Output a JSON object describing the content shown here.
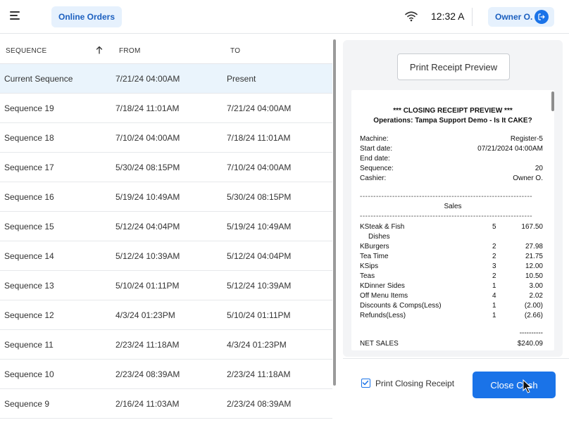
{
  "header": {
    "tab_label": "Online Orders",
    "time": "12:32 A",
    "user_name": "Owner O.",
    "menu_icon": "hamburger-menu-icon",
    "wifi_icon": "wifi-icon",
    "logout_icon": "logout-icon"
  },
  "table": {
    "columns": {
      "sequence": "SEQUENCE",
      "from": "FROM",
      "to": "TO"
    },
    "rows": [
      {
        "sequence": "Current Sequence",
        "from": "7/21/24 04:00AM",
        "to": "Present"
      },
      {
        "sequence": "Sequence 19",
        "from": "7/18/24 11:01AM",
        "to": "7/21/24 04:00AM"
      },
      {
        "sequence": "Sequence 18",
        "from": "7/10/24 04:00AM",
        "to": "7/18/24 11:01AM"
      },
      {
        "sequence": "Sequence 17",
        "from": "5/30/24 08:15PM",
        "to": "7/10/24 04:00AM"
      },
      {
        "sequence": "Sequence 16",
        "from": "5/19/24 10:49AM",
        "to": "5/30/24 08:15PM"
      },
      {
        "sequence": "Sequence 15",
        "from": "5/12/24 04:04PM",
        "to": "5/19/24 10:49AM"
      },
      {
        "sequence": "Sequence 14",
        "from": "5/12/24 10:39AM",
        "to": "5/12/24 04:04PM"
      },
      {
        "sequence": "Sequence 13",
        "from": "5/10/24 01:11PM",
        "to": "5/12/24 10:39AM"
      },
      {
        "sequence": "Sequence 12",
        "from": "4/3/24 01:23PM",
        "to": "5/10/24 01:11PM"
      },
      {
        "sequence": "Sequence 11",
        "from": "2/23/24 11:18AM",
        "to": "4/3/24 01:23PM"
      },
      {
        "sequence": "Sequence 10",
        "from": "2/23/24 08:39AM",
        "to": "2/23/24 11:18AM"
      },
      {
        "sequence": "Sequence 9",
        "from": "2/16/24 11:03AM",
        "to": "2/23/24 08:39AM"
      }
    ]
  },
  "panel": {
    "preview_button": "Print Receipt Preview",
    "receipt": {
      "title": "*** CLOSING RECEIPT PREVIEW ***",
      "subtitle": "Operations: Tampa Support Demo - Is It CAKE?",
      "info": [
        {
          "label": "Machine:",
          "value": "Register-5"
        },
        {
          "label": "Start date:",
          "value": "07/21/2024 04:00AM"
        },
        {
          "label": "End date:",
          "value": ""
        },
        {
          "label": "Sequence:",
          "value": "20"
        },
        {
          "label": "Cashier:",
          "value": "Owner O."
        }
      ],
      "dashes": "----------------------------------------------------------------",
      "sales_label": "Sales",
      "items": [
        {
          "name": "KSteak & Fish",
          "qty": "5",
          "amount": "167.50"
        },
        {
          "name": "Dishes",
          "qty": "",
          "amount": ""
        },
        {
          "name": "KBurgers",
          "qty": "2",
          "amount": "27.98"
        },
        {
          "name": "Tea Time",
          "qty": "2",
          "amount": "21.75"
        },
        {
          "name": "KSips",
          "qty": "3",
          "amount": "12.00"
        },
        {
          "name": "Teas",
          "qty": "2",
          "amount": "10.50"
        },
        {
          "name": "KDinner Sides",
          "qty": "1",
          "amount": "3.00"
        },
        {
          "name": "Off Menu Items",
          "qty": "4",
          "amount": "2.02"
        },
        {
          "name": "Discounts & Comps(Less)",
          "qty": "1",
          "amount": "(2.00)"
        },
        {
          "name": "Refunds(Less)",
          "qty": "1",
          "amount": "(2.66)"
        }
      ],
      "total_dashes": "----------",
      "net_sales_label": "NET SALES",
      "net_sales_value": "$240.09"
    }
  },
  "bottom": {
    "checkbox_label": "Print Closing Receipt",
    "checkbox_checked": true,
    "close_button": "Close Cash"
  },
  "colors": {
    "accent": "#1a73e8",
    "selected_row": "#eaf4fc",
    "pill": "#e6f1fd"
  }
}
